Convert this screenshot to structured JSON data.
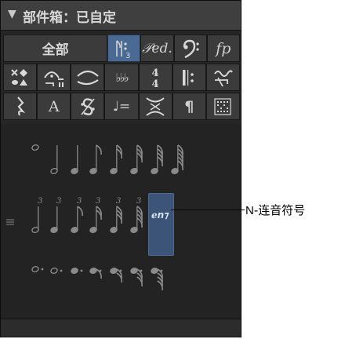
{
  "header": {
    "triangle": "▼",
    "title": "部件箱：已自定"
  },
  "tabs": {
    "all_label": "全部",
    "row1": [
      {
        "name": "tab-tuplets",
        "icon": "tuplet-icon",
        "selected": true
      },
      {
        "name": "tab-pedal",
        "icon": "pedal-icon",
        "text": "𝒫ed."
      },
      {
        "name": "tab-clef",
        "icon": "bass-clef-icon",
        "text": "𝄢"
      },
      {
        "name": "tab-dynamics",
        "icon": "dynamics-icon",
        "text": "fp"
      }
    ],
    "row2": [
      {
        "name": "tab-noteheads",
        "icon": "noteheads-icon"
      },
      {
        "name": "tab-fermata",
        "icon": "fermata-icon"
      },
      {
        "name": "tab-slur",
        "icon": "slur-icon"
      },
      {
        "name": "tab-accidentals",
        "icon": "accidentals-icon",
        "text": "♭♭♭"
      },
      {
        "name": "tab-time-signature",
        "icon": "time-signature-icon",
        "text": "4/4"
      },
      {
        "name": "tab-repeat",
        "icon": "repeat-icon"
      },
      {
        "name": "tab-ornaments",
        "icon": "ornament-icon"
      }
    ],
    "row3": [
      {
        "name": "tab-rests",
        "icon": "rest-icon",
        "text": "𝄽"
      },
      {
        "name": "tab-text",
        "icon": "text-icon",
        "text": "A"
      },
      {
        "name": "tab-segno",
        "icon": "segno-icon",
        "text": "𝄋"
      },
      {
        "name": "tab-tempo",
        "icon": "tempo-icon",
        "text": "♩="
      },
      {
        "name": "tab-bracket",
        "icon": "bracket-icon"
      },
      {
        "name": "tab-paragraph",
        "icon": "paragraph-icon",
        "text": "¶"
      },
      {
        "name": "tab-chord-grid",
        "icon": "chord-grid-icon"
      }
    ]
  },
  "palette": {
    "selected_item_label": "ℯn⁊",
    "tuplet_numeral": "3"
  },
  "callout": {
    "prefix": "N",
    "text": "-连音符号"
  },
  "colors": {
    "panel_bg": "#262626",
    "header_bg": "#3f3f3f",
    "selected_bg": "#4b6a93",
    "note_color": "#8a8a8a"
  }
}
